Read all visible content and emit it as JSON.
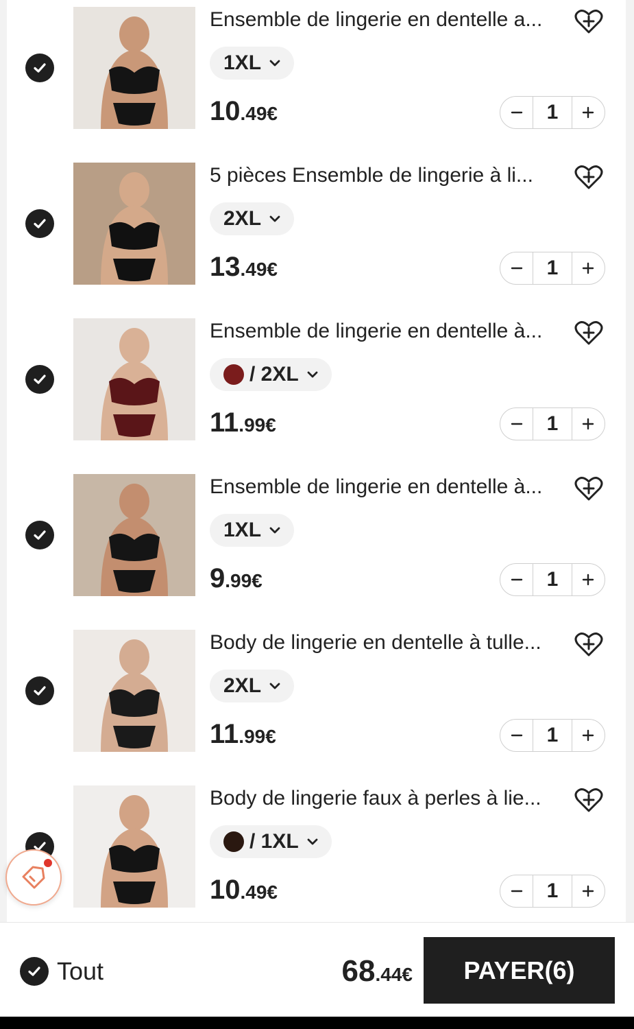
{
  "cart": {
    "items": [
      {
        "title": "Ensemble de lingerie en dentelle a...",
        "variant": "1XL",
        "swatch": "",
        "price_int": "10",
        "price_dec": ".49€",
        "qty": "1",
        "image": "product-photo-lace-bra-set"
      },
      {
        "title": "5 pièces Ensemble de lingerie à li...",
        "variant": "2XL",
        "swatch": "",
        "price_int": "13",
        "price_dec": ".49€",
        "qty": "1",
        "image": "product-photo-strappy-set"
      },
      {
        "title": "Ensemble de lingerie en dentelle à...",
        "variant": "/ 2XL",
        "swatch": "#7a1c1c",
        "price_int": "11",
        "price_dec": ".99€",
        "qty": "1",
        "image": "product-photo-red-lace-body"
      },
      {
        "title": "Ensemble de lingerie en dentelle à...",
        "variant": "1XL",
        "swatch": "",
        "price_int": "9",
        "price_dec": ".99€",
        "qty": "1",
        "image": "product-photo-black-lace-set"
      },
      {
        "title": "Body de lingerie en dentelle à tulle...",
        "variant": "2XL",
        "swatch": "",
        "price_int": "11",
        "price_dec": ".99€",
        "qty": "1",
        "image": "product-photo-tulle-bodysuit"
      },
      {
        "title": "Body de lingerie faux à perles à lie...",
        "variant": "/ 1XL",
        "swatch": "#2a1810",
        "price_int": "10",
        "price_dec": ".49€",
        "qty": "1",
        "image": "product-photo-pearl-bodysuit"
      }
    ]
  },
  "footer": {
    "select_all_label": "Tout",
    "total_int": "68",
    "total_dec": ".44€",
    "pay_label": "PAYER(6)"
  },
  "colors": {
    "dark": "#1f1f1f",
    "chip_bg": "#f2f2f2",
    "coupon_accent": "#e0362c"
  },
  "icons": {
    "check": "check-icon",
    "wishlist": "heart-plus-icon",
    "coupon": "coupon-tag-icon",
    "dropdown": "chevron-down-icon"
  }
}
